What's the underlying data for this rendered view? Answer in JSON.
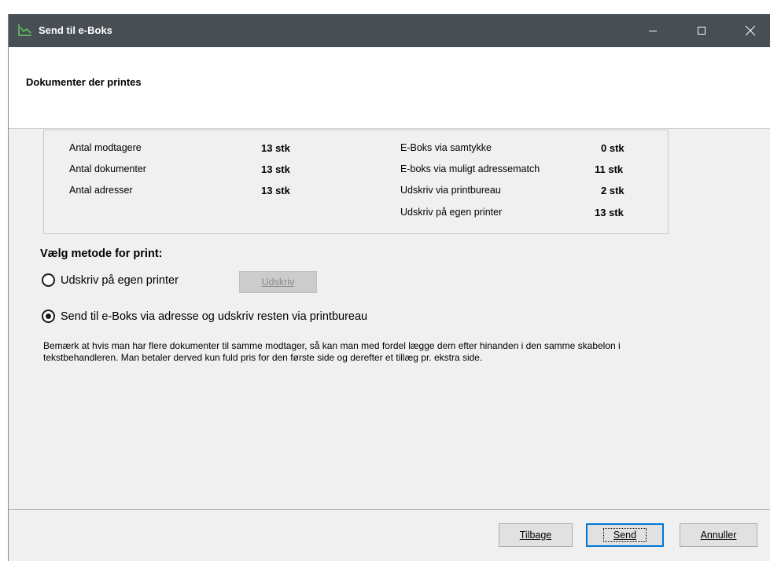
{
  "window": {
    "title": "Send til e-Boks",
    "icon": "chart-line-icon",
    "accent": "#474e54"
  },
  "header": {
    "title": "Dokumenter der printes"
  },
  "stats": {
    "left": [
      {
        "label": "Antal modtagere",
        "value": "13 stk"
      },
      {
        "label": "Antal dokumenter",
        "value": "13 stk"
      },
      {
        "label": "Antal adresser",
        "value": "13 stk"
      }
    ],
    "right": [
      {
        "label": "E-Boks via samtykke",
        "value": "0 stk"
      },
      {
        "label": "E-boks via muligt adressematch",
        "value": "11 stk"
      },
      {
        "label": "Udskriv via printbureau",
        "value": "2 stk"
      },
      {
        "label": "Udskriv på egen printer",
        "value": "13 stk"
      }
    ]
  },
  "method": {
    "heading": "Vælg metode for print:",
    "options": [
      {
        "label": "Udskriv på egen printer",
        "selected": false
      },
      {
        "label": "Send til e-Boks via adresse og udskriv resten via printbureau",
        "selected": true
      }
    ],
    "print_button": "Udskriv"
  },
  "note": "Bemærk at hvis man har flere dokumenter til samme modtager, så kan man med fordel lægge dem efter hinanden i den samme skabelon i tekstbehandleren. Man betaler derved kun fuld pris for den første side og derefter et tillæg pr. ekstra side.",
  "footer": {
    "back": "Tilbage",
    "send": "Send",
    "cancel": "Annuller"
  }
}
